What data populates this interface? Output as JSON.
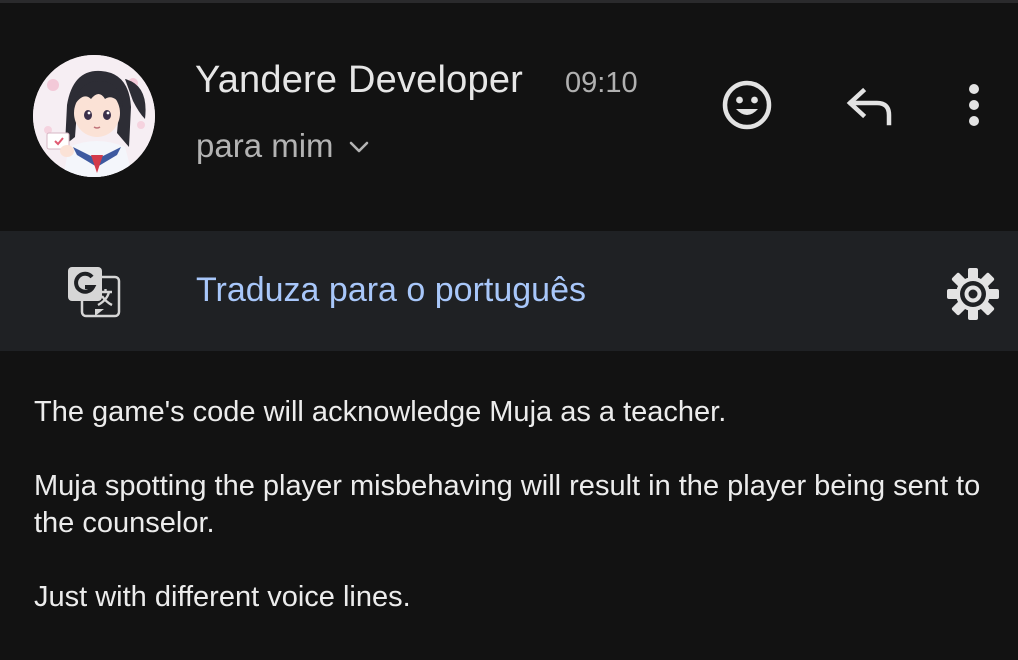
{
  "email": {
    "sender_name": "Yandere Developer",
    "time": "09:10",
    "recipient_label": "para mim"
  },
  "translate_bar": {
    "link_text": "Traduza para o português"
  },
  "message": {
    "paragraphs": [
      "The game's code will acknowledge Muja as a teacher.",
      "Muja spotting the player misbehaving will result in the player being sent to the counselor.",
      "Just with different voice lines."
    ]
  },
  "icons": {
    "emoji": "smiley-face-icon",
    "reply": "reply-arrow-icon",
    "more": "vertical-dots-icon",
    "translate": "google-translate-icon",
    "settings": "gear-icon",
    "recipient_toggle": "chevron-down-icon"
  },
  "colors": {
    "background": "#121212",
    "translate_bar": "#1f2124",
    "link": "#a8c7fa",
    "primary_text": "#e6e6e6",
    "secondary_text": "#b3b3b3"
  }
}
